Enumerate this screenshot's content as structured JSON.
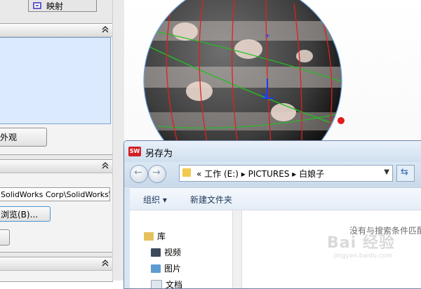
{
  "left_panel": {
    "mapping_tab_label": "映射",
    "appearance_button_label": "外观",
    "path_value": "SolidWorks Corp\\SolidWorks\\d",
    "browse_button_label": "浏览(B)..."
  },
  "dialog": {
    "title": "另存为",
    "logo_text": "SW",
    "breadcrumb": [
      "«",
      "工作 (E:)",
      "PICTURES",
      "白娘子"
    ],
    "toolbar": {
      "organize": "组织 ▾",
      "new_folder": "新建文件夹"
    },
    "nav_items": {
      "library": "库",
      "video": "视频",
      "pictures": "图片",
      "documents": "文档"
    },
    "empty_message": "没有与搜索条件匹配"
  },
  "watermark": {
    "brand": "Bai 经验",
    "url": "jingyan.baidu.com"
  },
  "colors": {
    "dialog_bg": "#d8e6f4",
    "list_selected": "#dbeafe",
    "sphere_lines_red": "#e02020",
    "sphere_lines_green": "#22c022",
    "logo_red": "#d21f26"
  }
}
